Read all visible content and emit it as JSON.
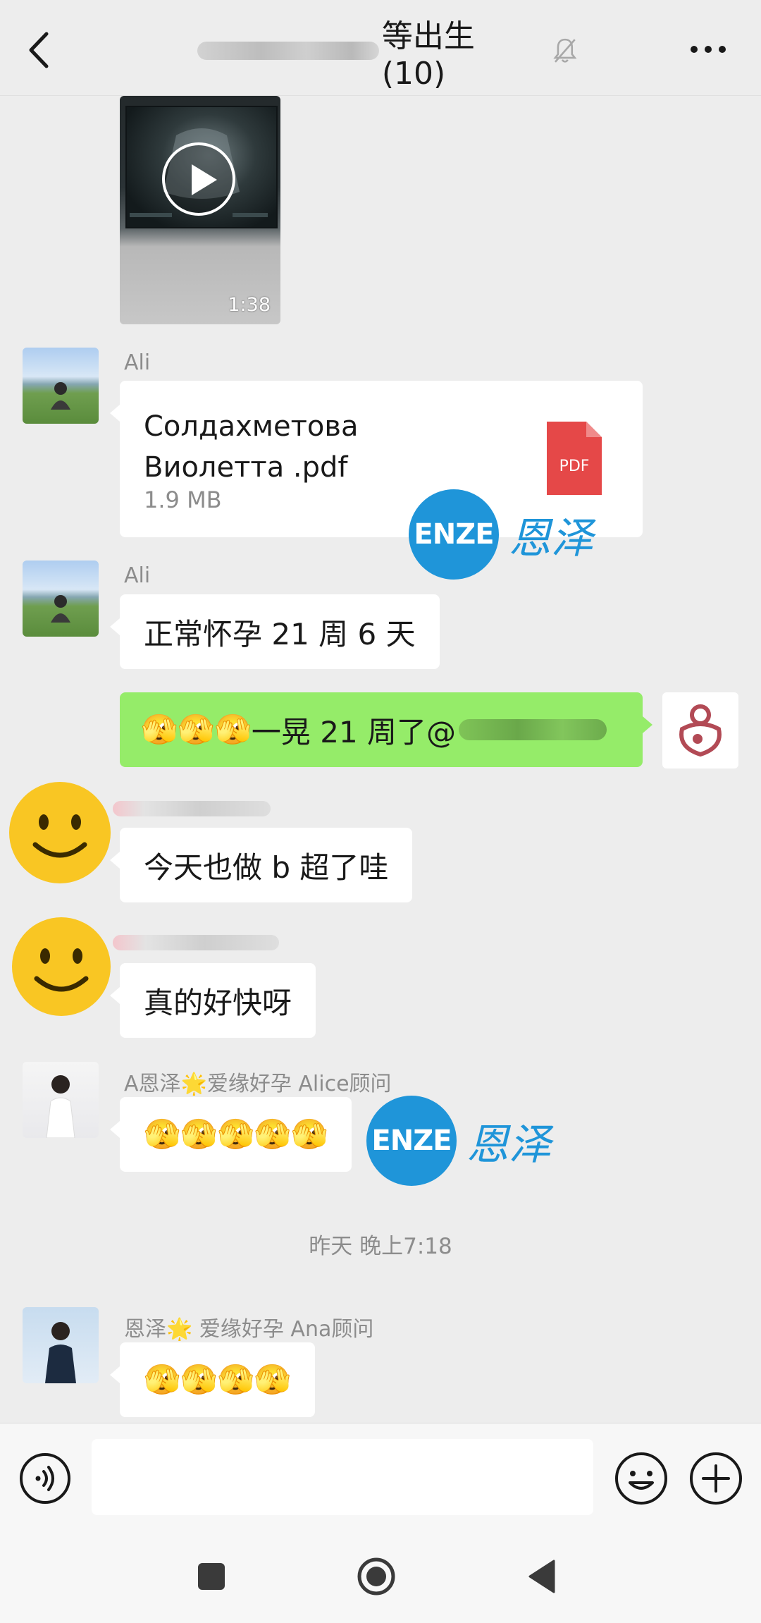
{
  "header": {
    "title_suffix": "等出生(10)"
  },
  "video": {
    "duration": "1:38"
  },
  "messages": {
    "file": {
      "sender": "Ali",
      "file_name": "Солдахметова Виолетта .pdf",
      "file_size": "1.9 MB",
      "file_icon_label": "PDF"
    },
    "ali_text": {
      "sender": "Ali",
      "text": "正常怀孕 21 周 6 天"
    },
    "self_text": {
      "emojis": "🫣🫣🫣",
      "text": "一晃 21 周了@"
    },
    "smiley1": {
      "text": "今天也做 b 超了哇"
    },
    "smiley2": {
      "text": "真的好快呀"
    },
    "alice": {
      "sender": "A恩泽🌟爱缘好孕 Alice顾问",
      "emojis": "🫣🫣🫣🫣🫣"
    },
    "timestamp": "昨天 晚上7:18",
    "ana": {
      "sender": "恩泽🌟 爱缘好孕 Ana顾问",
      "emojis": "🫣🫣🫣🫣"
    }
  },
  "watermark": {
    "badge": "ENZE",
    "text": "恩泽"
  },
  "input": {
    "placeholder": ""
  },
  "icons": {
    "back": "chevron-left-icon",
    "mute": "bell-off-icon",
    "more": "more-horizontal-icon",
    "voice": "voice-icon",
    "emoji": "emoji-icon",
    "plus": "plus-icon",
    "nav_recents": "square-icon",
    "nav_home": "circle-icon",
    "nav_back": "triangle-icon"
  },
  "colors": {
    "background": "#ededed",
    "bubble_self": "#95ec69",
    "bubble_other": "#ffffff",
    "watermark_blue": "#1f95d9",
    "pdf_red": "#e54848"
  }
}
